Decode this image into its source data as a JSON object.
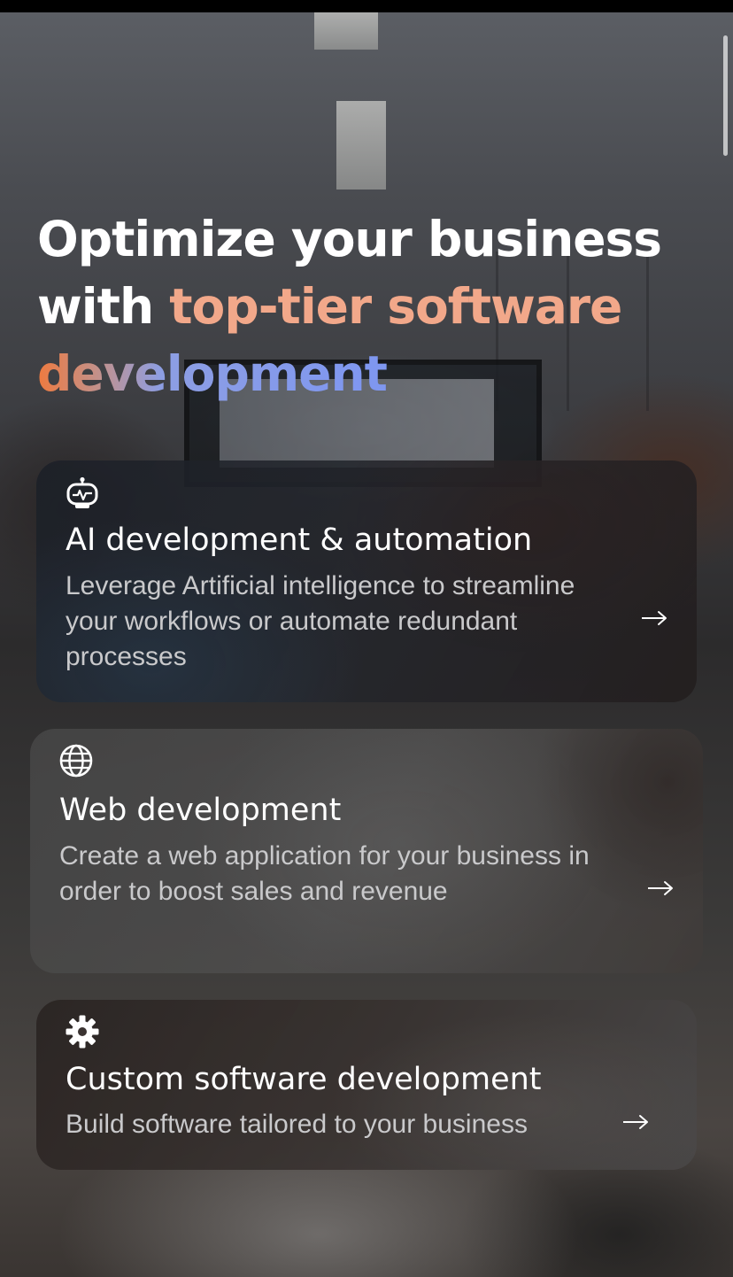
{
  "hero": {
    "title_line1": "Optimize your business",
    "title_line2_prefix": "with ",
    "title_highlight": "top-tier software",
    "title_highlight2": "development"
  },
  "services": [
    {
      "icon": "robot-icon",
      "title": "AI development & automation",
      "description": "Leverage Artificial intelligence to streamline your workflows or automate redundant processes",
      "arrow_icon": "arrow-right-icon"
    },
    {
      "icon": "globe-icon",
      "title": "Web development",
      "description": "Create a web application for your business in order to boost sales and revenue",
      "arrow_icon": "arrow-right-icon"
    },
    {
      "icon": "gear-icon",
      "title": "Custom software development",
      "description": "Build software tailored to your business",
      "arrow_icon": "arrow-right-icon"
    }
  ],
  "colors": {
    "highlight_peach": "#f2a88a",
    "gradient_orange": "#ee7a3f",
    "gradient_blue": "#7f97f0",
    "description_text": "#c9c9cb"
  }
}
